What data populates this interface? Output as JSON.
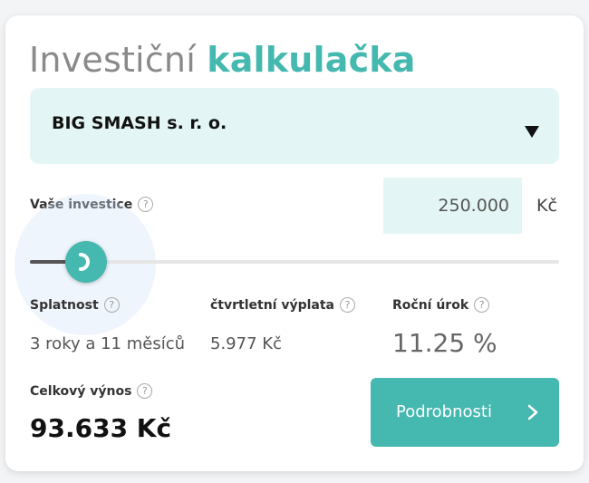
{
  "title": {
    "light": "Investiční",
    "accent": "kalkulačka"
  },
  "company_select": {
    "selected": "BIG SMASH s. r. o."
  },
  "investment": {
    "label": "Vaše investice",
    "help": "?",
    "amount": "250.000",
    "currency": "Kč",
    "slider_fraction": 0.11
  },
  "maturity": {
    "label": "Splatnost",
    "help": "?",
    "value": "3 roky a 11 měsíců"
  },
  "quarterly_payout": {
    "label": "čtvrtletní výplata",
    "help": "?",
    "value": "5.977 Kč"
  },
  "annual_rate": {
    "label": "Roční úrok",
    "help": "?",
    "value": "11.25 %"
  },
  "total_return": {
    "label": "Celkový výnos",
    "help": "?",
    "value": "93.633 Kč"
  },
  "details_button": {
    "label": "Podrobnosti"
  },
  "colors": {
    "accent": "#45b8b0",
    "field_bg": "#e3f6f5",
    "title_gray": "#8a8a8a"
  }
}
